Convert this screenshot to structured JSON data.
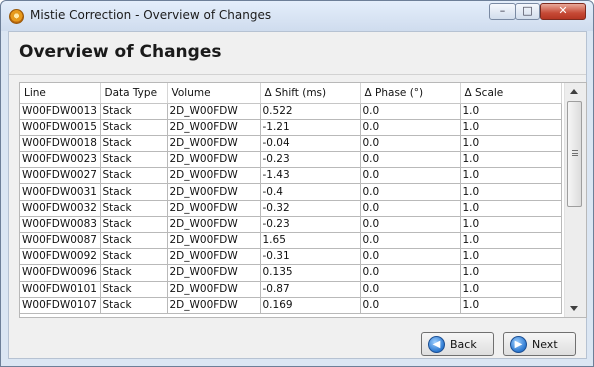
{
  "window": {
    "title": "Mistie Correction - Overview of Changes",
    "minimize_glyph": "–",
    "maximize_glyph": "□",
    "close_glyph": "✕"
  },
  "page": {
    "title": "Overview of Changes"
  },
  "table": {
    "columns": [
      "Line",
      "Data Type",
      "Volume",
      "Δ Shift (ms)",
      "Δ Phase (°)",
      "Δ Scale"
    ],
    "rows": [
      [
        "W00FDW0013",
        "Stack",
        "2D_W00FDW",
        "0.522",
        "0.0",
        "1.0"
      ],
      [
        "W00FDW0015",
        "Stack",
        "2D_W00FDW",
        "-1.21",
        "0.0",
        "1.0"
      ],
      [
        "W00FDW0018",
        "Stack",
        "2D_W00FDW",
        "-0.04",
        "0.0",
        "1.0"
      ],
      [
        "W00FDW0023",
        "Stack",
        "2D_W00FDW",
        "-0.23",
        "0.0",
        "1.0"
      ],
      [
        "W00FDW0027",
        "Stack",
        "2D_W00FDW",
        "-1.43",
        "0.0",
        "1.0"
      ],
      [
        "W00FDW0031",
        "Stack",
        "2D_W00FDW",
        "-0.4",
        "0.0",
        "1.0"
      ],
      [
        "W00FDW0032",
        "Stack",
        "2D_W00FDW",
        "-0.32",
        "0.0",
        "1.0"
      ],
      [
        "W00FDW0083",
        "Stack",
        "2D_W00FDW",
        "-0.23",
        "0.0",
        "1.0"
      ],
      [
        "W00FDW0087",
        "Stack",
        "2D_W00FDW",
        "1.65",
        "0.0",
        "1.0"
      ],
      [
        "W00FDW0092",
        "Stack",
        "2D_W00FDW",
        "-0.31",
        "0.0",
        "1.0"
      ],
      [
        "W00FDW0096",
        "Stack",
        "2D_W00FDW",
        "0.135",
        "0.0",
        "1.0"
      ],
      [
        "W00FDW0101",
        "Stack",
        "2D_W00FDW",
        "-0.87",
        "0.0",
        "1.0"
      ],
      [
        "W00FDW0107",
        "Stack",
        "2D_W00FDW",
        "0.169",
        "0.0",
        "1.0"
      ]
    ]
  },
  "buttons": {
    "back_label": "Back",
    "next_label": "Next"
  },
  "icons": {
    "app": "app-logo-icon",
    "back": "arrow-left-icon",
    "next": "arrow-right-icon"
  }
}
